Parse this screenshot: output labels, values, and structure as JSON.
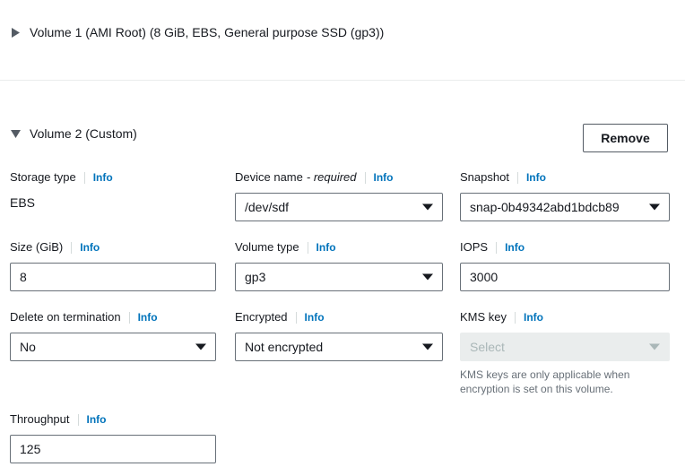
{
  "colors": {
    "link": "#0073bb",
    "text": "#16191f",
    "muted": "#687078",
    "disabled_text": "#aab7b8",
    "disabled_bg": "#eaeded",
    "border": "#687078",
    "divider": "#eaeded",
    "button_border": "#545b64"
  },
  "info_label": "Info",
  "volume1": {
    "title": "Volume 1 (AMI Root) (8 GiB, EBS, General purpose SSD (gp3))",
    "expanded": false,
    "twisty_icon": "triangle-right-icon"
  },
  "volume2": {
    "title": "Volume 2 (Custom)",
    "expanded": true,
    "twisty_icon": "triangle-down-icon",
    "remove_label": "Remove",
    "fields": {
      "storage_type": {
        "label": "Storage type",
        "value": "EBS",
        "type": "static"
      },
      "device_name": {
        "label": "Device name",
        "required_suffix": "- required",
        "value": "/dev/sdf",
        "type": "select"
      },
      "snapshot": {
        "label": "Snapshot",
        "value": "snap-0b49342abd1bdcb89",
        "type": "select"
      },
      "size": {
        "label": "Size (GiB)",
        "value": "8",
        "type": "input"
      },
      "volume_type": {
        "label": "Volume type",
        "value": "gp3",
        "type": "select"
      },
      "iops": {
        "label": "IOPS",
        "value": "3000",
        "type": "input"
      },
      "delete_on_termination": {
        "label": "Delete on termination",
        "value": "No",
        "type": "select"
      },
      "encrypted": {
        "label": "Encrypted",
        "value": "Not encrypted",
        "type": "select"
      },
      "kms_key": {
        "label": "KMS key",
        "placeholder": "Select",
        "type": "select",
        "disabled": true,
        "helper": "KMS keys are only applicable when encryption is set on this volume."
      },
      "throughput": {
        "label": "Throughput",
        "value": "125",
        "type": "input"
      }
    }
  }
}
